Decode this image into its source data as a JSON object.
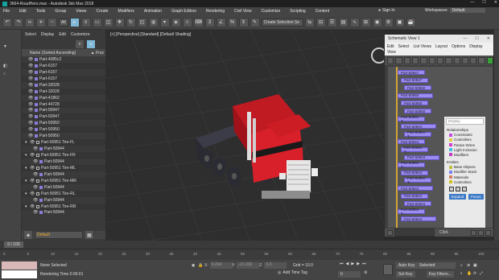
{
  "window": {
    "title": "3664-RoadHero.max - Autodesk 3ds Max 2018",
    "controls": [
      "—",
      "☐",
      "✕"
    ]
  },
  "menu": {
    "items": [
      "File",
      "Edit",
      "Tools",
      "Group",
      "Views",
      "Create",
      "Modifiers",
      "Animation",
      "Graph Editors",
      "Rendering",
      "Civil View",
      "Customize",
      "Scripting",
      "Content"
    ],
    "signin": "Sign In",
    "workspace_label": "Workspaces:",
    "workspace_value": "Default"
  },
  "toolbar": {
    "filter_value": "All",
    "selset_placeholder": "Create Selection Se"
  },
  "scene_explorer": {
    "menu": [
      "Select",
      "Display",
      "Edit",
      "Customize"
    ],
    "header": "Name (Sorted Ascending)",
    "header2": "▲ Froz",
    "rows": [
      "Part-4085c2",
      "Part-6157",
      "Part-6157",
      "Part-6157",
      "Part-32028",
      "Part-32028",
      "Part-41862",
      "Part-44728",
      "Part-50947",
      "Part-50947",
      "Part-50950",
      "Part-50950",
      "Part-50950",
      "Part-50951 Tire-FL",
      "Part-50944",
      "Part-50951 Tire-FR",
      "Part-50944",
      "Part-50951 Tire-ML",
      "Part-50944",
      "Part-50951 Tire-MR",
      "Part-50944",
      "Part-50951 Tire-RL",
      "Part-50944",
      "Part-50951 Tire-RR",
      "Part-50944"
    ]
  },
  "layer": {
    "value": "Default"
  },
  "viewport": {
    "label": "[+] [Perspective] [Standard] [Default Shading]"
  },
  "schematic": {
    "title": "Schematic View 1",
    "menu": [
      "Edit",
      "Select",
      "List Views",
      "Layout",
      "Options",
      "Display"
    ],
    "menu2": "View",
    "nodes": [
      "Part-50947",
      "Part-50947",
      "Part-50950",
      "Part-50950",
      "Part-50950",
      "Part-50950",
      "Part-50951 T...",
      "Part-50944",
      "Part-50951 T...",
      "Part-50944",
      "Part-50951 T...",
      "Part-50944",
      "Part-50951 T...",
      "Part-50944",
      "Part-50951 T...",
      "Part-50944",
      "Part-50944",
      "Part-50944",
      "Part-50951 T...",
      "Part-50944"
    ],
    "display": {
      "placeholder": "Display",
      "relationships_title": "Relationships",
      "relationships": [
        {
          "label": "Constraints",
          "color": "#c44ee0"
        },
        {
          "label": "Controllers",
          "color": "#e0d040"
        },
        {
          "label": "Param Wires",
          "color": "#d040d0"
        },
        {
          "label": "Light Inclusion",
          "color": "#40c0e0"
        },
        {
          "label": "Modifiers",
          "color": "#c040c0"
        }
      ],
      "entities_title": "Entities",
      "entities": [
        {
          "label": "Base Objects",
          "color": "#c0c040"
        },
        {
          "label": "Modifier Stack",
          "color": "#8080f0"
        },
        {
          "label": "Materials",
          "color": "#d08060"
        },
        {
          "label": "Controllers",
          "color": "#d0c020"
        }
      ],
      "buttons": [
        "Expand",
        "Focus"
      ]
    },
    "bottom_text": "Click"
  },
  "timeline": {
    "slider": "0 / 100",
    "ticks": [
      "0",
      "5",
      "10",
      "15",
      "20",
      "25",
      "30",
      "35",
      "40",
      "45",
      "50",
      "55",
      "60",
      "65",
      "70",
      "75",
      "80",
      "85",
      "90",
      "95",
      "100"
    ]
  },
  "status": {
    "selection": "None Selected",
    "render_time": "Rendering Time  0:00:01",
    "x_label": "X:",
    "x_value": "9.204",
    "y_label": "Y:",
    "y_value": "-21.002",
    "z_label": "Z:",
    "z_value": "0.0",
    "grid": "Grid = 10.0",
    "add_time_tag": "Add Time Tag",
    "auto_key": "Auto Key",
    "set_key": "Set Key",
    "selected": "Selected",
    "key_filters": "Key Filters...",
    "frame": "0"
  },
  "colors": {
    "truck_red": "#d8202a",
    "wheel": "#3a3a44",
    "node": "#9b8df0",
    "accent": "#3d7ac7"
  }
}
